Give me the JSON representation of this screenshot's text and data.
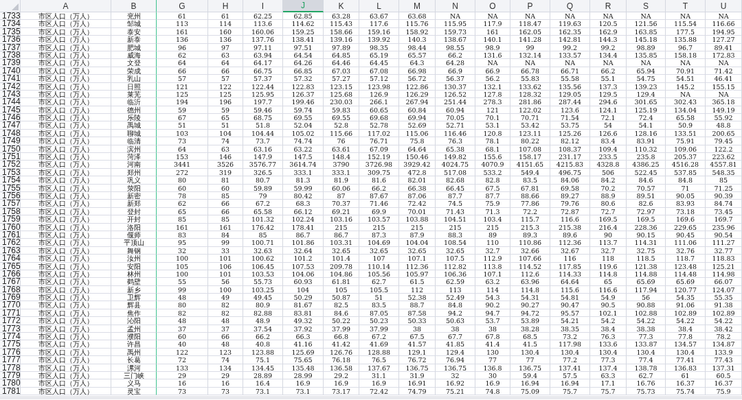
{
  "columns": [
    {
      "label": "A",
      "selected": false,
      "freeze_line": false
    },
    {
      "label": "B",
      "selected": false,
      "freeze_line": true
    },
    {
      "label": "G",
      "selected": false,
      "freeze_line": false
    },
    {
      "label": "H",
      "selected": false,
      "freeze_line": false
    },
    {
      "label": "I",
      "selected": false,
      "freeze_line": false
    },
    {
      "label": "J",
      "selected": true,
      "freeze_line": false
    },
    {
      "label": "K",
      "selected": false,
      "freeze_line": false
    },
    {
      "label": "L",
      "selected": false,
      "freeze_line": false
    },
    {
      "label": "M",
      "selected": false,
      "freeze_line": false
    },
    {
      "label": "N",
      "selected": false,
      "freeze_line": false
    },
    {
      "label": "O",
      "selected": false,
      "freeze_line": false
    },
    {
      "label": "P",
      "selected": false,
      "freeze_line": false
    },
    {
      "label": "Q",
      "selected": false,
      "freeze_line": false
    },
    {
      "label": "R",
      "selected": false,
      "freeze_line": false
    },
    {
      "label": "S",
      "selected": false,
      "freeze_line": false
    },
    {
      "label": "T",
      "selected": false,
      "freeze_line": false
    },
    {
      "label": "U",
      "selected": false,
      "freeze_line": false
    }
  ],
  "rows": [
    {
      "number": "1733",
      "cells": [
        "市区人口（万人）",
        "兖州",
        "61",
        "61",
        "62.25",
        "62.85",
        "63.28",
        "63.67",
        "63.68",
        "NA",
        "NA",
        "NA",
        "NA",
        "NA",
        "NA",
        "NA",
        "NA"
      ]
    },
    {
      "number": "1734",
      "cells": [
        "市区人口（万人）",
        "邹城",
        "113",
        "114",
        "113.6",
        "114.62",
        "115.43",
        "117.6",
        "115.76",
        "115.95",
        "117.9",
        "118.47",
        "119.63",
        "120.5",
        "121.56",
        "115.54",
        "116.66"
      ]
    },
    {
      "number": "1735",
      "cells": [
        "市区人口（万人）",
        "泰安",
        "161",
        "160",
        "160.06",
        "159.25",
        "158.66",
        "159.16",
        "158.92",
        "159.73",
        "161",
        "162.05",
        "162.35",
        "162.9",
        "163.85",
        "177.5",
        "194.95"
      ]
    },
    {
      "number": "1736",
      "cells": [
        "市区人口（万人）",
        "新泰",
        "136",
        "136",
        "137.76",
        "138.41",
        "139.16",
        "139.92",
        "140.3",
        "138.67",
        "140.1",
        "141.28",
        "142.81",
        "144.3",
        "145.18",
        "135.88",
        "127.27"
      ]
    },
    {
      "number": "1737",
      "cells": [
        "市区人口（万人）",
        "肥城",
        "96",
        "97",
        "97.11",
        "97.51",
        "97.89",
        "98.35",
        "98.44",
        "98.55",
        "98.9",
        "99",
        "99.2",
        "99.2",
        "98.89",
        "96.7",
        "89.41"
      ]
    },
    {
      "number": "1738",
      "cells": [
        "市区人口（万人）",
        "威海",
        "62",
        "63",
        "63.94",
        "64.54",
        "64.85",
        "65.19",
        "65.57",
        "66.2",
        "131.6",
        "132.14",
        "133.57",
        "134.4",
        "135.85",
        "158.18",
        "172.83"
      ]
    },
    {
      "number": "1739",
      "cells": [
        "市区人口（万人）",
        "文登",
        "64",
        "64",
        "64.17",
        "64.26",
        "64.46",
        "64.45",
        "64.3",
        "64.28",
        "NA",
        "NA",
        "NA",
        "NA",
        "NA",
        "NA",
        "NA"
      ]
    },
    {
      "number": "1740",
      "cells": [
        "市区人口（万人）",
        "荣成",
        "66",
        "66",
        "66.75",
        "66.85",
        "67.03",
        "67.08",
        "66.98",
        "66.9",
        "66.9",
        "66.78",
        "66.71",
        "66.2",
        "65.94",
        "70.91",
        "71.42"
      ]
    },
    {
      "number": "1741",
      "cells": [
        "市区人口（万人）",
        "乳山",
        "57",
        "57",
        "57.37",
        "57.32",
        "57.27",
        "57.12",
        "56.72",
        "56.37",
        "56.2",
        "55.83",
        "55.58",
        "55.1",
        "54.75",
        "54.51",
        "46.41"
      ]
    },
    {
      "number": "1742",
      "cells": [
        "市区人口（万人）",
        "日照",
        "121",
        "122",
        "122.44",
        "122.83",
        "123.15",
        "123.98",
        "122.86",
        "130.37",
        "132.1",
        "133.62",
        "135.56",
        "137.3",
        "139.23",
        "145.2",
        "155.15"
      ]
    },
    {
      "number": "1743",
      "cells": [
        "市区人口（万人）",
        "莱芜",
        "125",
        "125",
        "125.95",
        "126.37",
        "125.68",
        "126.9",
        "126.29",
        "126.52",
        "127.8",
        "128.32",
        "129.05",
        "129.5",
        "129.4",
        "NA",
        "NA"
      ]
    },
    {
      "number": "1744",
      "cells": [
        "市区人口（万人）",
        "临沂",
        "194",
        "196",
        "197.7",
        "199.46",
        "230.03",
        "266.1",
        "267.94",
        "251.44",
        "278.3",
        "281.86",
        "287.44",
        "294.6",
        "301.65",
        "302.43",
        "365.18"
      ]
    },
    {
      "number": "1745",
      "cells": [
        "市区人口（万人）",
        "德州",
        "59",
        "59",
        "59.46",
        "59.74",
        "59.83",
        "60.65",
        "60.84",
        "60.94",
        "121",
        "122.02",
        "123.6",
        "124.1",
        "125.19",
        "134.04",
        "149.19"
      ]
    },
    {
      "number": "1746",
      "cells": [
        "市区人口（万人）",
        "乐陵",
        "67",
        "65",
        "68.75",
        "69.55",
        "69.55",
        "69.68",
        "69.94",
        "70.05",
        "70.1",
        "70.71",
        "71.54",
        "72.1",
        "72.4",
        "65.58",
        "55.92"
      ]
    },
    {
      "number": "1747",
      "cells": [
        "市区人口（万人）",
        "禹城",
        "51",
        "51",
        "51.8",
        "52.04",
        "52.8",
        "52.78",
        "52.69",
        "52.71",
        "53.1",
        "53.42",
        "53.75",
        "54",
        "54.1",
        "50.9",
        "48.8"
      ]
    },
    {
      "number": "1748",
      "cells": [
        "市区人口（万人）",
        "聊城",
        "103",
        "104",
        "104.44",
        "105.02",
        "115.66",
        "117.02",
        "115.06",
        "116.46",
        "120.8",
        "123.11",
        "125.26",
        "126.6",
        "128.16",
        "133.51",
        "200.65"
      ]
    },
    {
      "number": "1749",
      "cells": [
        "市区人口（万人）",
        "临清",
        "73",
        "74",
        "73.7",
        "74.74",
        "76",
        "76.71",
        "75.8",
        "76.3",
        "78.1",
        "80.22",
        "82.12",
        "83.4",
        "83.91",
        "75.91",
        "79.45"
      ]
    },
    {
      "number": "1750",
      "cells": [
        "市区人口（万人）",
        "滨州",
        "64",
        "63",
        "63.16",
        "63.22",
        "63.61",
        "67.09",
        "64.64",
        "65.38",
        "68.1",
        "107.08",
        "108.37",
        "109.4",
        "110.32",
        "109.06",
        "122.2"
      ]
    },
    {
      "number": "1751",
      "cells": [
        "市区人口（万人）",
        "菏泽",
        "153",
        "146",
        "147.9",
        "147.5",
        "148.4",
        "152.19",
        "150.46",
        "149.82",
        "155.6",
        "158.17",
        "231.17",
        "233.5",
        "235.8",
        "205.37",
        "223.62"
      ]
    },
    {
      "number": "1752",
      "cells": [
        "市区人口（万人）",
        "河南",
        "3441",
        "3526",
        "3576.77",
        "3614.74",
        "3790",
        "3726.98",
        "3929.42",
        "4024.75",
        "4070.9",
        "4151.65",
        "4215.83",
        "4328.8",
        "4386.25",
        "4516.28",
        "4557.81"
      ]
    },
    {
      "number": "1753",
      "cells": [
        "市区人口（万人）",
        "郑州",
        "272",
        "319",
        "326.5",
        "333.1",
        "333.1",
        "309.75",
        "472.8",
        "517.08",
        "533.2",
        "549.4",
        "496.75",
        "506",
        "522.45",
        "537.85",
        "548.35"
      ]
    },
    {
      "number": "1754",
      "cells": [
        "市区人口（万人）",
        "巩义",
        "80",
        "81",
        "80.7",
        "81.3",
        "81.9",
        "81.6",
        "82.01",
        "82.68",
        "82.8",
        "83.5",
        "84.06",
        "84.2",
        "84.6",
        "84.8",
        "85"
      ]
    },
    {
      "number": "1755",
      "cells": [
        "市区人口（万人）",
        "荥阳",
        "60",
        "60",
        "59.89",
        "59.99",
        "60.06",
        "66.2",
        "66.38",
        "66.45",
        "67.5",
        "67.81",
        "69.58",
        "70.2",
        "70.57",
        "71",
        "71.25"
      ]
    },
    {
      "number": "1756",
      "cells": [
        "市区人口（万人）",
        "新密",
        "78",
        "85",
        "79",
        "80.42",
        "87",
        "87.67",
        "87.06",
        "87.7",
        "87.7",
        "88.66",
        "89.27",
        "88.9",
        "89.51",
        "90.05",
        "90.39"
      ]
    },
    {
      "number": "1757",
      "cells": [
        "市区人口（万人）",
        "新郑",
        "62",
        "66",
        "67.2",
        "68.3",
        "70.37",
        "71.46",
        "72.42",
        "74.5",
        "75.9",
        "77.86",
        "79.76",
        "80.6",
        "82.6",
        "83.93",
        "84.74"
      ]
    },
    {
      "number": "1758",
      "cells": [
        "市区人口（万人）",
        "登封",
        "65",
        "66",
        "65.58",
        "66.12",
        "69.21",
        "69.9",
        "70.01",
        "71.43",
        "71.3",
        "72.2",
        "72.87",
        "72.7",
        "72.97",
        "73.18",
        "73.45"
      ]
    },
    {
      "number": "1759",
      "cells": [
        "市区人口（万人）",
        "开封",
        "85",
        "85",
        "101.32",
        "102.24",
        "103.16",
        "103.57",
        "103.88",
        "104.51",
        "103.4",
        "115.7",
        "116.6",
        "169.5",
        "169.5",
        "169.6",
        "169.7"
      ]
    },
    {
      "number": "1760",
      "cells": [
        "市区人口（万人）",
        "洛阳",
        "161",
        "161",
        "176.42",
        "178.41",
        "215",
        "215",
        "215",
        "215",
        "215",
        "215.3",
        "215.38",
        "216.4",
        "228.36",
        "229.65",
        "235.96"
      ]
    },
    {
      "number": "1761",
      "cells": [
        "市区人口（万人）",
        "偃师",
        "83",
        "84",
        "85",
        "86.7",
        "86.7",
        "87.3",
        "87.9",
        "88.3",
        "89",
        "89.3",
        "89.6",
        "90",
        "90.15",
        "90.45",
        "90.54"
      ]
    },
    {
      "number": "1762",
      "cells": [
        "市区人口（万人）",
        "平顶山",
        "95",
        "99",
        "100.71",
        "101.86",
        "103.31",
        "104.69",
        "104.04",
        "108.54",
        "110",
        "110.86",
        "112.36",
        "113.7",
        "114.31",
        "111.06",
        "111.27"
      ]
    },
    {
      "number": "1763",
      "cells": [
        "市区人口（万人）",
        "舞钢",
        "32",
        "33",
        "32.63",
        "32.64",
        "32.65",
        "32.65",
        "32.65",
        "32.65",
        "32.7",
        "32.66",
        "32.67",
        "32.7",
        "32.75",
        "32.76",
        "32.77"
      ]
    },
    {
      "number": "1764",
      "cells": [
        "市区人口（万人）",
        "汝州",
        "100",
        "101",
        "100.62",
        "101.2",
        "101.4",
        "107",
        "107.1",
        "107.5",
        "112.9",
        "107.66",
        "116",
        "118",
        "118.5",
        "118.7",
        "118.83"
      ]
    },
    {
      "number": "1765",
      "cells": [
        "市区人口（万人）",
        "安阳",
        "105",
        "106",
        "106.45",
        "107.53",
        "209.78",
        "110.14",
        "112.36",
        "112.82",
        "113.8",
        "114.52",
        "117.85",
        "119.6",
        "121.38",
        "123.48",
        "125.21"
      ]
    },
    {
      "number": "1766",
      "cells": [
        "市区人口（万人）",
        "林州",
        "100",
        "101",
        "103.53",
        "104.06",
        "104.86",
        "105.56",
        "105.97",
        "106.36",
        "107.1",
        "112.6",
        "114.33",
        "114.8",
        "114.88",
        "114.48",
        "114.98"
      ]
    },
    {
      "number": "1767",
      "cells": [
        "市区人口（万人）",
        "鹤壁",
        "55",
        "56",
        "55.73",
        "60.93",
        "61.81",
        "62.7",
        "61.5",
        "62.59",
        "63.2",
        "63.96",
        "64.64",
        "65",
        "65.69",
        "65.69",
        "66.07"
      ]
    },
    {
      "number": "1768",
      "cells": [
        "市区人口（万人）",
        "新乡",
        "99",
        "100",
        "103.25",
        "104",
        "105",
        "105.5",
        "112",
        "113",
        "114",
        "114.8",
        "115.6",
        "116.6",
        "117.94",
        "120.77",
        "124.07"
      ]
    },
    {
      "number": "1769",
      "cells": [
        "市区人口（万人）",
        "卫辉",
        "48",
        "49",
        "49.45",
        "50.29",
        "50.87",
        "51",
        "52.38",
        "52.49",
        "54.3",
        "54.31",
        "54.81",
        "54.9",
        "56",
        "54.35",
        "55.35"
      ]
    },
    {
      "number": "1770",
      "cells": [
        "市区人口（万人）",
        "辉县",
        "80",
        "82",
        "80.9",
        "81.67",
        "82.5",
        "83.5",
        "88.7",
        "84.8",
        "90.2",
        "90.27",
        "90.47",
        "90.5",
        "90.88",
        "91.06",
        "91.38"
      ]
    },
    {
      "number": "1771",
      "cells": [
        "市区人口（万人）",
        "焦作",
        "82",
        "82",
        "82.88",
        "83.81",
        "84.6",
        "87.05",
        "87.58",
        "94.2",
        "94.7",
        "94.72",
        "95.57",
        "102.1",
        "102.88",
        "102.89",
        "102.89"
      ]
    },
    {
      "number": "1772",
      "cells": [
        "市区人口（万人）",
        "沁阳",
        "48",
        "48",
        "48.9",
        "49.32",
        "50.22",
        "50.23",
        "50.33",
        "50.63",
        "53.7",
        "53.89",
        "54.21",
        "54.2",
        "54.22",
        "54.22",
        "54.22"
      ]
    },
    {
      "number": "1773",
      "cells": [
        "市区人口（万人）",
        "孟州",
        "37",
        "37",
        "37.54",
        "37.92",
        "37.99",
        "37.99",
        "38",
        "38",
        "38",
        "38.28",
        "38.35",
        "38.4",
        "38.38",
        "38.4",
        "38.42"
      ]
    },
    {
      "number": "1774",
      "cells": [
        "市区人口（万人）",
        "濮阳",
        "60",
        "66",
        "66.2",
        "66.3",
        "66.8",
        "67.2",
        "67.5",
        "67.7",
        "67.8",
        "68.5",
        "73.2",
        "76.3",
        "77.3",
        "77.8",
        "78.2"
      ]
    },
    {
      "number": "1775",
      "cells": [
        "市区人口（万人）",
        "许昌",
        "40",
        "48",
        "40.8",
        "41.16",
        "41.42",
        "41.69",
        "41.57",
        "41.85",
        "41.4",
        "41.5",
        "117.98",
        "133.6",
        "133.87",
        "134.57",
        "134.87"
      ]
    },
    {
      "number": "1776",
      "cells": [
        "市区人口（万人）",
        "禹州",
        "122",
        "123",
        "123.88",
        "125.69",
        "126.76",
        "128.88",
        "129.1",
        "129.4",
        "130",
        "130.4",
        "130.4",
        "130.4",
        "130.4",
        "130.4",
        "133.9"
      ]
    },
    {
      "number": "1777",
      "cells": [
        "市区人口（万人）",
        "长葛",
        "72",
        "74",
        "75.1",
        "75.65",
        "76.18",
        "76.5",
        "76.72",
        "76.94",
        "77",
        "77",
        "77.2",
        "77.3",
        "77.4",
        "77.41",
        "77.43"
      ]
    },
    {
      "number": "1778",
      "cells": [
        "市区人口（万人）",
        "漯河",
        "133",
        "134",
        "134.45",
        "135.48",
        "136.58",
        "137.67",
        "136.75",
        "136.75",
        "136.8",
        "136.75",
        "137.41",
        "137.4",
        "138.78",
        "136.83",
        "137.31"
      ]
    },
    {
      "number": "1779",
      "cells": [
        "市区人口（万人）",
        "三门峡",
        "29",
        "29",
        "28.89",
        "28.99",
        "29.2",
        "31.1",
        "31.9",
        "32",
        "30",
        "59.4",
        "57.5",
        "63.3",
        "62.7",
        "61",
        "60.5"
      ]
    },
    {
      "number": "1780",
      "cells": [
        "市区人口（万人）",
        "义马",
        "16",
        "16",
        "16.4",
        "16.9",
        "16.9",
        "16.9",
        "16.91",
        "16.92",
        "16.9",
        "16.94",
        "16.94",
        "17.1",
        "16.76",
        "16.37",
        "16.37"
      ]
    },
    {
      "number": "1781",
      "cells": [
        "市区人口（万人）",
        "灵宝",
        "73",
        "73",
        "73.1",
        "73.1",
        "73.17",
        "72.42",
        "74.79",
        "75.21",
        "74.8",
        "75.09",
        "75.7",
        "75.7",
        "75.73",
        "75.74",
        "75.9"
      ]
    }
  ]
}
